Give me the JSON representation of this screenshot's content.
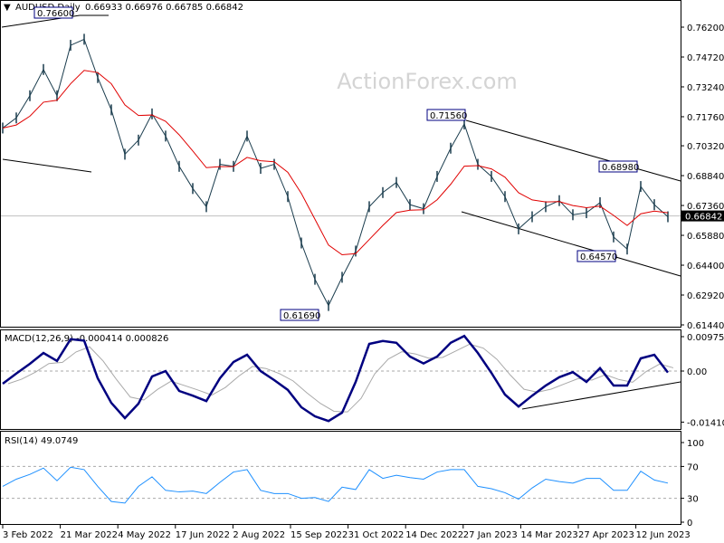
{
  "header": {
    "symbol": "AUDUSD,Daily",
    "ohlc": "0.66933 0.66976 0.66785 0.66842"
  },
  "watermark": "ActionForex.com",
  "colors": {
    "price": "#1a3c4d",
    "ma": "#e00000",
    "macd": "#000080",
    "signal": "#a9a9a9",
    "rsi": "#1e90ff",
    "current_price_bg": "#000000"
  },
  "chart_data": [
    {
      "type": "line",
      "title": "AUDUSD,Daily",
      "x_tick_labels": [
        "3 Feb 2022",
        "21 Mar 2022",
        "4 May 2022",
        "17 Jun 2022",
        "2 Aug 2022",
        "15 Sep 2022",
        "31 Oct 2022",
        "14 Dec 2022",
        "27 Jan 2023",
        "14 Mar 2023",
        "27 Apr 2023",
        "12 Jun 2023"
      ],
      "y_tick_labels": [
        "0.76200",
        "0.74720",
        "0.73240",
        "0.71760",
        "0.70320",
        "0.68840",
        "0.67360",
        "0.65880",
        "0.64400",
        "0.62920",
        "0.61440"
      ],
      "ylim": [
        0.6144,
        0.762
      ],
      "current_price": "0.66842",
      "annotations": [
        "0.76600",
        "0.71560",
        "0.61690",
        "0.68980",
        "0.64570"
      ],
      "series": [
        {
          "values": [
            0.712,
            0.717,
            0.728,
            0.741,
            0.728,
            0.753,
            0.756,
            0.737,
            0.721,
            0.699,
            0.706,
            0.719,
            0.708,
            0.693,
            0.682,
            0.673,
            0.694,
            0.693,
            0.708,
            0.692,
            0.694,
            0.678,
            0.655,
            0.637,
            0.624,
            0.638,
            0.651,
            0.673,
            0.68,
            0.685,
            0.674,
            0.672,
            0.688,
            0.702,
            0.714,
            0.694,
            0.688,
            0.678,
            0.662,
            0.668,
            0.673,
            0.676,
            0.669,
            0.67,
            0.675,
            0.658,
            0.652,
            0.683,
            0.674,
            0.668
          ]
        }
      ]
    },
    {
      "type": "line",
      "title": "MACD(12,26,9) -0.000414 0.000826",
      "y_tick_labels": [
        "0.009751",
        "0.00",
        "-0.014107"
      ],
      "ylim": [
        -0.014107,
        0.009751
      ],
      "series": [
        {
          "values": [
            -0.0035,
            -0.0007,
            0.002,
            0.005,
            0.0028,
            0.0088,
            0.0084,
            -0.002,
            -0.0088,
            -0.013,
            -0.009,
            -0.0015,
            0.0,
            -0.0055,
            -0.0068,
            -0.0083,
            -0.002,
            0.0025,
            0.0045,
            0.0,
            -0.0025,
            -0.0052,
            -0.01,
            -0.0125,
            -0.0138,
            -0.0115,
            -0.003,
            0.0075,
            0.0083,
            0.0078,
            0.004,
            0.0021,
            0.004,
            0.0078,
            0.0097,
            0.005,
            -0.0005,
            -0.0065,
            -0.0098,
            -0.0068,
            -0.004,
            -0.0017,
            -0.0003,
            -0.003,
            0.0008,
            -0.004,
            -0.004,
            0.0035,
            0.0045,
            -0.0004
          ]
        }
      ]
    },
    {
      "type": "line",
      "title": "RSI(14) 49.0749",
      "y_tick_labels": [
        "100",
        "70",
        "30",
        "0"
      ],
      "ylim": [
        0,
        100
      ],
      "series": [
        {
          "values": [
            45,
            54,
            60,
            68,
            52,
            69,
            66,
            45,
            26,
            24,
            45,
            57,
            40,
            38,
            39,
            36,
            50,
            63,
            66,
            40,
            36,
            36,
            30,
            31,
            26,
            44,
            41,
            66,
            55,
            59,
            56,
            54,
            63,
            66,
            66,
            45,
            42,
            37,
            29,
            43,
            54,
            51,
            49,
            55,
            55,
            40,
            40,
            64,
            53,
            49.07
          ]
        }
      ]
    }
  ]
}
